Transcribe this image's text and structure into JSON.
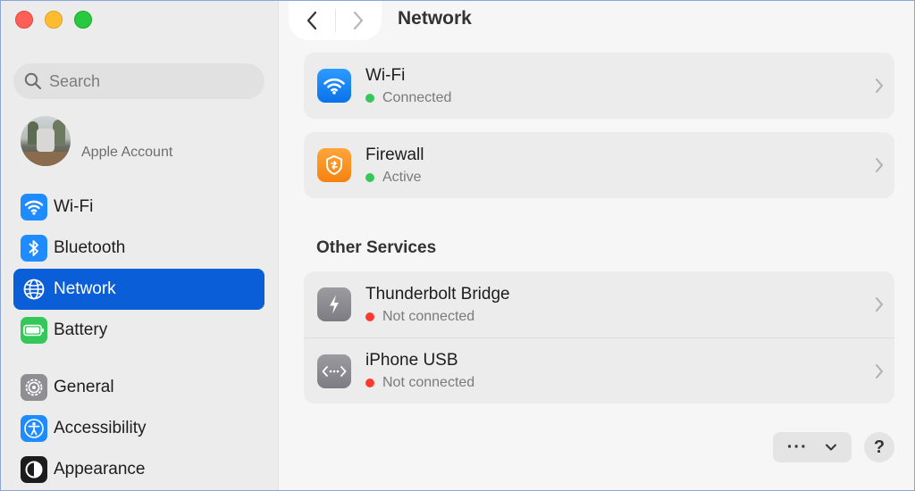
{
  "window": {
    "title": "Network"
  },
  "sidebar": {
    "search": {
      "placeholder": "Search",
      "value": ""
    },
    "account": {
      "label": "Apple Account"
    },
    "items": [
      {
        "label": "Wi-Fi",
        "icon": "wifi-icon",
        "active": false
      },
      {
        "label": "Bluetooth",
        "icon": "bluetooth-icon",
        "active": false
      },
      {
        "label": "Network",
        "icon": "globe-icon",
        "active": true
      },
      {
        "label": "Battery",
        "icon": "battery-icon",
        "active": false
      },
      {
        "label": "General",
        "icon": "gear-icon",
        "active": false
      },
      {
        "label": "Accessibility",
        "icon": "accessibility-icon",
        "active": false
      },
      {
        "label": "Appearance",
        "icon": "appearance-icon",
        "active": false
      }
    ]
  },
  "main": {
    "services": [
      {
        "title": "Wi-Fi",
        "status": "Connected",
        "status_color": "#34c759",
        "icon": "wifi-icon"
      },
      {
        "title": "Firewall",
        "status": "Active",
        "status_color": "#34c759",
        "icon": "firewall-icon"
      }
    ],
    "other_services_title": "Other Services",
    "other_services": [
      {
        "title": "Thunderbolt Bridge",
        "status": "Not connected",
        "status_color": "#ff3b30",
        "icon": "thunderbolt-icon"
      },
      {
        "title": "iPhone USB",
        "status": "Not connected",
        "status_color": "#ff3b30",
        "icon": "usb-icon"
      }
    ],
    "actions_label": "···",
    "help_label": "?"
  },
  "colors": {
    "accent": "#0a5ed7",
    "connected": "#34c759",
    "disconnected": "#ff3b30"
  }
}
